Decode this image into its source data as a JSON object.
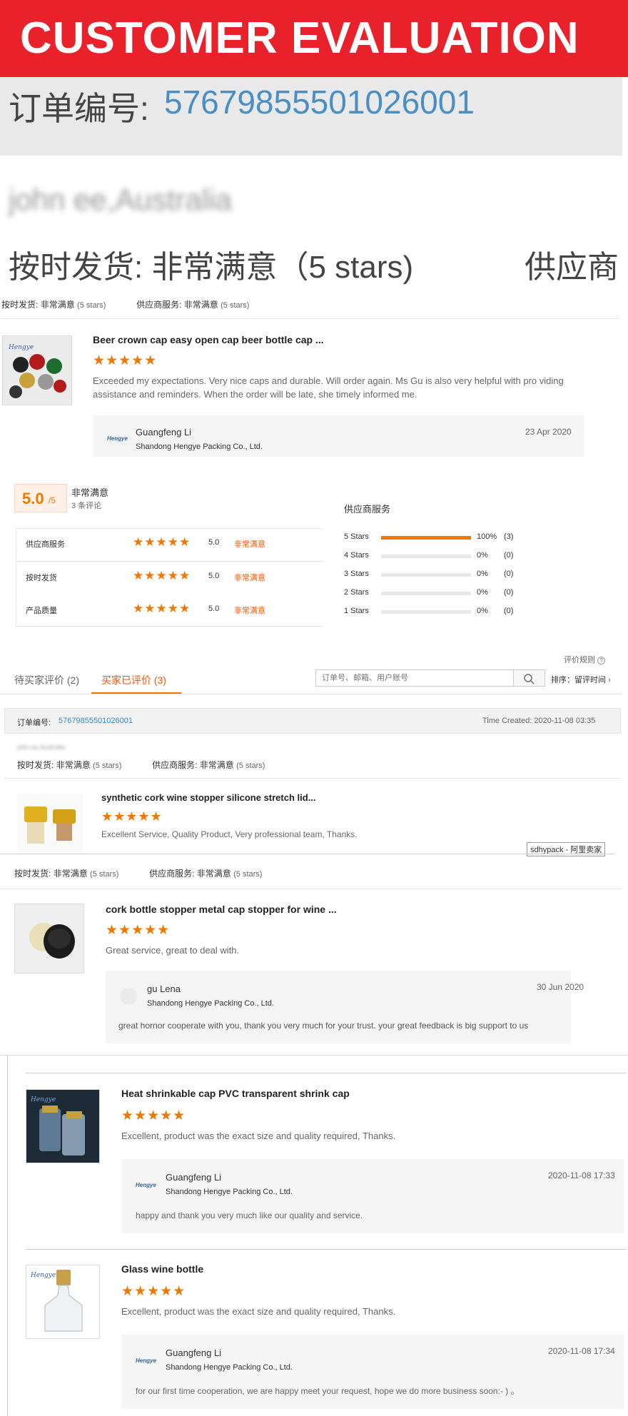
{
  "banner": {
    "title": "CUSTOMER EVALUATION"
  },
  "order_strip": {
    "label": "订单编号:",
    "number": "57679855501026001"
  },
  "blur_name": "john ee,Australia",
  "big_rating": {
    "text": "按时发货: 非常满意（5 stars)",
    "cut": "供应商"
  },
  "meta": {
    "ship_label": "按时发货:",
    "ship_value": "非常满意",
    "ship_stars": "(5 stars)",
    "service_label": "供应商服务:",
    "service_value": "非常满意",
    "service_stars": "(5 stars)"
  },
  "review1": {
    "title": "Beer crown cap easy open cap beer bottle cap ...",
    "stars": "★★★★★",
    "text": "Exceeded my expectations. Very nice caps and durable. Will order again. Ms Gu is also very helpful with pro viding assistance and reminders. When the order will be late, she timely informed me.",
    "seller": "Guangfeng Li",
    "company": "Shandong Hengye Packing Co., Ltd.",
    "date": "23 Apr 2020"
  },
  "rating_panel": {
    "score": "5.0",
    "score_suffix": "/5",
    "level": "非常满意",
    "count": "3 条评论",
    "rows": [
      {
        "label": "供应商服务",
        "stars": "★★★★★",
        "value": "5.0",
        "level": "非常满意"
      },
      {
        "label": "按时发货",
        "stars": "★★★★★",
        "value": "5.0",
        "level": "非常满意"
      },
      {
        "label": "产品质量",
        "stars": "★★★★★",
        "value": "5.0",
        "level": "非常满意"
      }
    ],
    "dist_title": "供应商服务",
    "dist": [
      {
        "label": "5 Stars",
        "fraction": 1.0,
        "pct": "100%",
        "count": "(3)"
      },
      {
        "label": "4 Stars",
        "fraction": 0.0,
        "pct": "0%",
        "count": "(0)"
      },
      {
        "label": "3 Stars",
        "fraction": 0.0,
        "pct": "0%",
        "count": "(0)"
      },
      {
        "label": "2 Stars",
        "fraction": 0.0,
        "pct": "0%",
        "count": "(0)"
      },
      {
        "label": "1 Stars",
        "fraction": 0.0,
        "pct": "0%",
        "count": "(0)"
      }
    ]
  },
  "tabs": {
    "rules": "评价规则",
    "pending": "待买家评价 (2)",
    "done": "买家已评价 (3)",
    "search_placeholder": "订单号、邮箱、用户账号",
    "sort": "排序：留评时间"
  },
  "order_row": {
    "label": "订单编号:",
    "number": "57679855501026001",
    "time": "Time Created: 2020-11-08 03:35",
    "blur": "john ee,Australia"
  },
  "review2": {
    "title": "synthetic cork wine stopper silicone stretch lid...",
    "stars": "★★★★★",
    "text": "Excellent Service, Quality Product, Very professional team, Thanks.",
    "tag": "sdhypack - 阿里卖家"
  },
  "review3": {
    "title": "cork bottle stopper metal cap stopper for wine ...",
    "stars": "★★★★★",
    "text": "Great service, great to deal with.",
    "seller": "gu Lena",
    "company": "Shandong Hengye Packing Co., Ltd.",
    "date": "30 Jun 2020",
    "reply": "great hornor cooperate with you, thank you very much for your trust. your great feedback is big support to us"
  },
  "review4": {
    "title": "Heat shrinkable cap PVC transparent shrink cap",
    "stars": "★★★★★",
    "text": "Excellent, product was the exact size and quality required, Thanks.",
    "seller": "Guangfeng Li",
    "company": "Shandong Hengye Packing Co., Ltd.",
    "date": "2020-11-08 17:33",
    "reply": "happy and thank you very much like our quality and service."
  },
  "review5": {
    "title": "Glass wine bottle",
    "stars": "★★★★★",
    "text": "Excellent, product was the exact size and quality required, Thanks.",
    "seller": "Guangfeng Li",
    "company": "Shandong Hengye Packing Co., Ltd.",
    "date": "2020-11-08 17:34",
    "reply": "for our first time cooperation, we are happy meet your request, hope we do more business soon:- ) 。"
  },
  "logo_text": "Hengye",
  "colors": {
    "accent": "#f07800",
    "banner": "#e8212a",
    "link": "#3c8dc8",
    "level": "#ff5500"
  }
}
